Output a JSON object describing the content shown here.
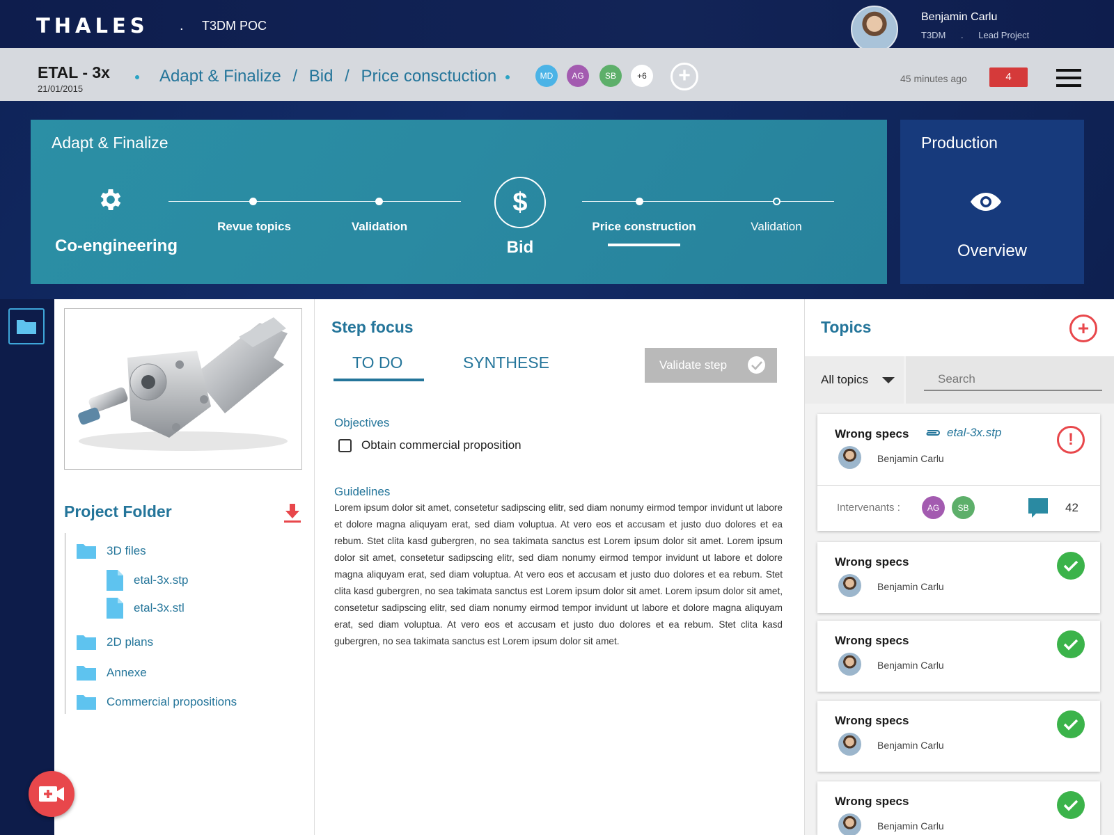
{
  "header": {
    "logo": "THALES",
    "separator": ".",
    "app_name": "T3DM POC",
    "user": {
      "name": "Benjamin Carlu",
      "org": "T3DM",
      "dot": ".",
      "role": "Lead Project"
    }
  },
  "breadcrumb_bar": {
    "project": "ETAL - 3x",
    "date": "21/01/2015",
    "crumbs": [
      "Adapt & Finalize",
      "/",
      "Bid",
      "/",
      "Price consctuction"
    ],
    "members": [
      {
        "initials": "MD",
        "color": "#4bb3e6"
      },
      {
        "initials": "AG",
        "color": "#a35bb0"
      },
      {
        "initials": "SB",
        "color": "#5daf6a"
      },
      {
        "initials": "+6",
        "color": "#ffffff"
      }
    ],
    "add_member": "+",
    "time_ago": "45 minutes ago",
    "notifications": "4",
    "menu_icon": "hamburger-menu-icon"
  },
  "process": {
    "phase_title": "Adapt & Finalize",
    "co_engineering": {
      "label": "Co-engineering",
      "icon": "gear-icon"
    },
    "steps_left": [
      "Revue topics",
      "Validation"
    ],
    "bid": {
      "symbol": "$",
      "label": "Bid"
    },
    "steps_right": [
      "Price construction",
      "Validation"
    ],
    "production": {
      "title": "Production",
      "label": "Overview",
      "icon": "eye-icon"
    }
  },
  "project_folder": {
    "title": "Project Folder",
    "tree": [
      {
        "name": "3D files",
        "type": "folder"
      },
      {
        "name": "etal-3x.stp",
        "type": "file"
      },
      {
        "name": "etal-3x.stl",
        "type": "file"
      },
      {
        "name": "2D plans",
        "type": "folder"
      },
      {
        "name": "Annexe",
        "type": "folder"
      },
      {
        "name": "Commercial propositions",
        "type": "folder"
      }
    ]
  },
  "step_focus": {
    "title": "Step focus",
    "tabs": [
      "TO DO",
      "SYNTHESE"
    ],
    "validate_label": "Validate step",
    "objectives_title": "Objectives",
    "objective": "Obtain commercial proposition",
    "guidelines_title": "Guidelines",
    "guidelines_text": "Lorem ipsum dolor sit amet, consetetur sadipscing elitr, sed diam nonumy eirmod tempor invidunt ut labore et dolore magna aliquyam erat, sed diam voluptua. At vero eos et accusam et justo duo dolores et ea rebum. Stet clita kasd gubergren, no sea takimata sanctus est Lorem ipsum dolor sit amet. Lorem ipsum dolor sit amet, consetetur sadipscing elitr, sed diam nonumy eirmod tempor invidunt ut labore et dolore magna aliquyam erat, sed diam voluptua. At vero eos et accusam et justo duo dolores et ea rebum. Stet clita kasd gubergren, no sea takimata sanctus est Lorem ipsum dolor sit amet. Lorem ipsum dolor sit amet, consetetur sadipscing elitr, sed diam nonumy eirmod tempor invidunt ut labore et dolore magna aliquyam erat, sed diam voluptua. At vero eos et accusam et justo duo dolores et ea rebum. Stet clita kasd gubergren, no sea takimata sanctus est Lorem ipsum dolor sit amet."
  },
  "topics": {
    "title": "Topics",
    "add": "+",
    "filter": "All topics",
    "search_placeholder": "Search",
    "cards": [
      {
        "title": "Wrong specs",
        "author": "Benjamin Carlu",
        "attachment": "etal-3x.stp",
        "status": "warning",
        "status_symbol": "!",
        "intervenants_label": "Intervenants :",
        "intervenants": [
          {
            "initials": "AG",
            "color": "#a35bb0"
          },
          {
            "initials": "SB",
            "color": "#5daf6a"
          }
        ],
        "comments": "42"
      },
      {
        "title": "Wrong specs",
        "author": "Benjamin Carlu",
        "status": "done"
      },
      {
        "title": "Wrong specs",
        "author": "Benjamin Carlu",
        "status": "done"
      },
      {
        "title": "Wrong specs",
        "author": "Benjamin Carlu",
        "status": "done"
      },
      {
        "title": "Wrong specs",
        "author": "Benjamin Carlu",
        "status": "done"
      }
    ]
  },
  "colors": {
    "accent": "#24759a",
    "teal_panel": "#2a8aa2",
    "navy": "#0d1c4a",
    "alert": "#e8474b",
    "success": "#3bb34a"
  }
}
